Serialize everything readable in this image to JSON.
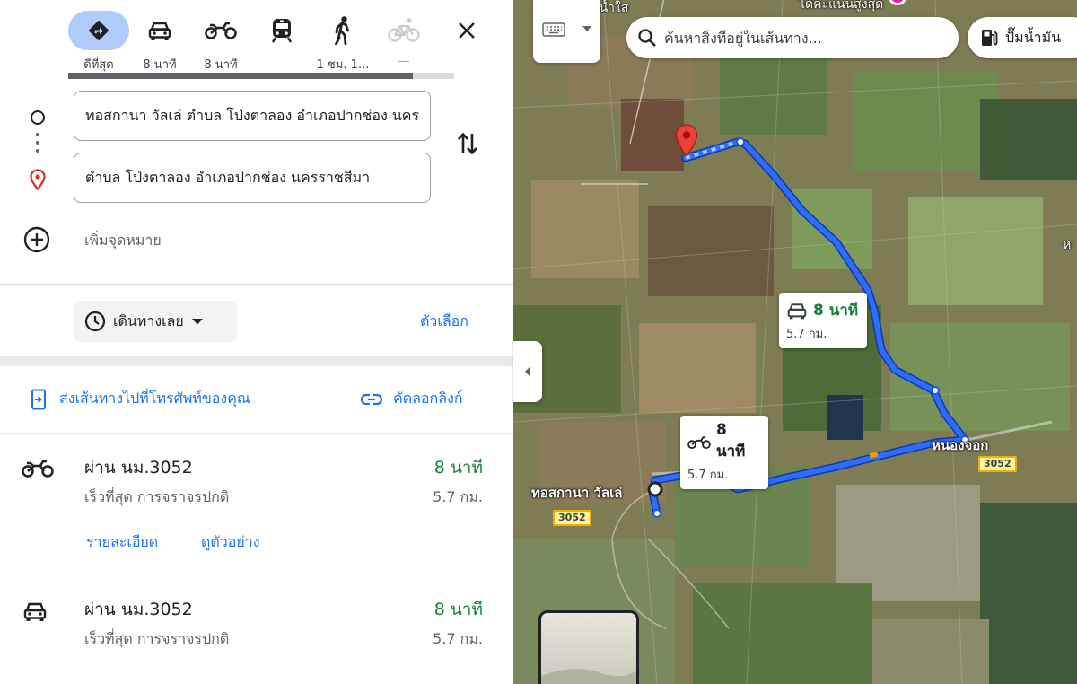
{
  "modes": [
    {
      "name": "best",
      "label": "ดีที่สุด",
      "icon": "directions-icon"
    },
    {
      "name": "drive",
      "label": "8 นาที",
      "icon": "car-icon"
    },
    {
      "name": "motorbike",
      "label": "8 นาที",
      "icon": "motorbike-icon"
    },
    {
      "name": "transit",
      "label": "",
      "icon": "train-icon"
    },
    {
      "name": "walk",
      "label": "1 ชม. 1...",
      "icon": "walk-icon"
    },
    {
      "name": "bicycle",
      "label": "—",
      "icon": "bicycle-icon"
    }
  ],
  "origin": {
    "value": "ทอสกานา วัลเล่ ตำบล โป่งตาลอง อำเภอปากช่อง นครราชสีมา"
  },
  "destination": {
    "value": "ตำบล โป่งตาลอง อำเภอปากช่อง นครราชสีมา"
  },
  "add_destination": "เพิ่มจุดหมาย",
  "depart": {
    "label": "เดินทางเลย"
  },
  "options_label": "ตัวเลือก",
  "share": {
    "send_to_phone": "ส่งเส้นทางไปที่โทรศัพท์ของคุณ",
    "copy_link": "คัดลอกลิงก์"
  },
  "routes": [
    {
      "mode": "motorbike",
      "via": "ผ่าน นม.3052",
      "duration": "8 นาที",
      "desc": "เร็วที่สุด การจราจรปกติ",
      "distance": "5.7 กม.",
      "details_label": "รายละเอียด",
      "preview_label": "ดูตัวอย่าง"
    },
    {
      "mode": "car",
      "via": "ผ่าน นม.3052",
      "duration": "8 นาที",
      "desc": "เร็วที่สุด การจราจรปกติ",
      "distance": "5.7 กม."
    }
  ],
  "map": {
    "search_placeholder": "ค้นหาสิ่งที่อยู่ในเส้นทาง...",
    "chip_label": "ปั๊มน้ำมัน",
    "car_bubble": {
      "time": "8 นาที",
      "dist": "5.7 กม."
    },
    "bike_bubble": {
      "time": "8 นาที",
      "dist": "5.7 กม."
    },
    "labels": {
      "origin_place": "ทอสกานา วัลเล่",
      "nong_chok": "หนองจอก",
      "top_left": "สระน้ำใส",
      "top_right": "ได้คะแนนสูงสุด",
      "edge_right": "ห",
      "road_3052_a": "3052",
      "road_3052_b": "3052"
    },
    "colors": {
      "route": "#1a56f0",
      "route_border": "#0b3aa8",
      "pin": "#ea4335"
    }
  }
}
